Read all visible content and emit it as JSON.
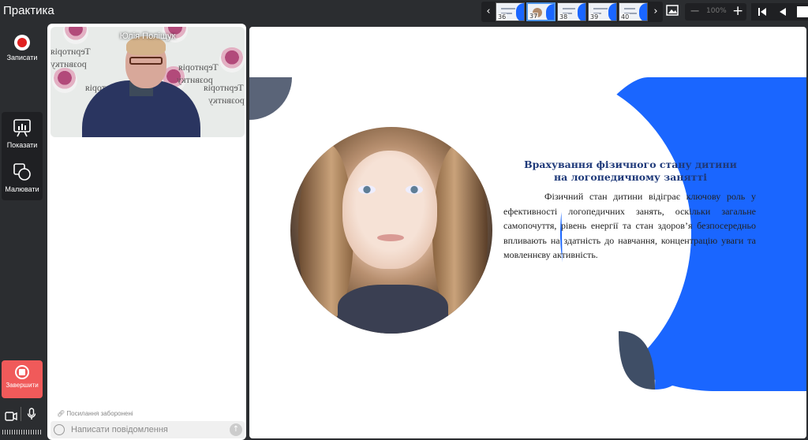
{
  "app": {
    "title": "Практика"
  },
  "thumbnails": [
    {
      "num": "36"
    },
    {
      "num": "37"
    },
    {
      "num": "38"
    },
    {
      "num": "39"
    },
    {
      "num": "40"
    }
  ],
  "zoom": {
    "value": "100%"
  },
  "sidebar": {
    "record": "Записати",
    "show": "Показати",
    "draw": "Малювати",
    "end": "Завершити"
  },
  "video": {
    "participant_name": "Юлія Поліщук",
    "banner_texts": [
      "Територія",
      "розвитку"
    ]
  },
  "chat": {
    "links_notice": "Посилання заборонені",
    "placeholder": "Написати повідомлення"
  },
  "slide": {
    "title": "Врахування фізичного стану дитини на логопедичному занятті",
    "body": "Фізичний стан дитини відіграє ключову роль у ефективності логопедичних занять, оскільки загальне самопочуття, рівень енергії та стан здоров’я безпосередньо впливають на здатність до навчання, концентрацію уваги та мовленнєву активність."
  },
  "colors": {
    "accent_blue": "#1a66ff",
    "slate": "#3f4e66",
    "end_red": "#f05a5a"
  }
}
